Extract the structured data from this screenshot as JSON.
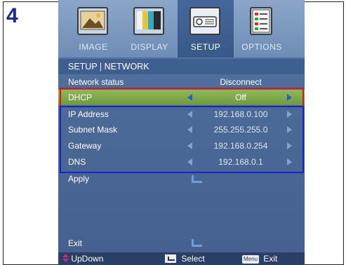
{
  "step_number": "4",
  "tabs": [
    {
      "label": "IMAGE",
      "icon": "image-icon"
    },
    {
      "label": "DISPLAY",
      "icon": "display-icon"
    },
    {
      "label": "SETUP",
      "icon": "projector-icon",
      "active": true
    },
    {
      "label": "OPTIONS",
      "icon": "options-icon"
    }
  ],
  "title": "SETUP | NETWORK",
  "rows": [
    {
      "label": "Network status",
      "value": "Disconnect"
    },
    {
      "label": "DHCP",
      "value": "Off"
    },
    {
      "label": "IP Address",
      "value": "192.168.0.100"
    },
    {
      "label": "Subnet Mask",
      "value": "255.255.255.0"
    },
    {
      "label": "Gateway",
      "value": "192.168.0.254"
    },
    {
      "label": "DNS",
      "value": "192.168.0.1"
    },
    {
      "label": "Apply"
    },
    {
      "label": "Exit"
    }
  ],
  "footer": {
    "updown": "UpDown",
    "select": "Select",
    "menu_badge": "Menu",
    "exit": "Exit"
  },
  "colors": {
    "highlight_red": "#e0141a",
    "highlight_blue": "#1a22c8",
    "selected_row": "#8fb85a"
  }
}
